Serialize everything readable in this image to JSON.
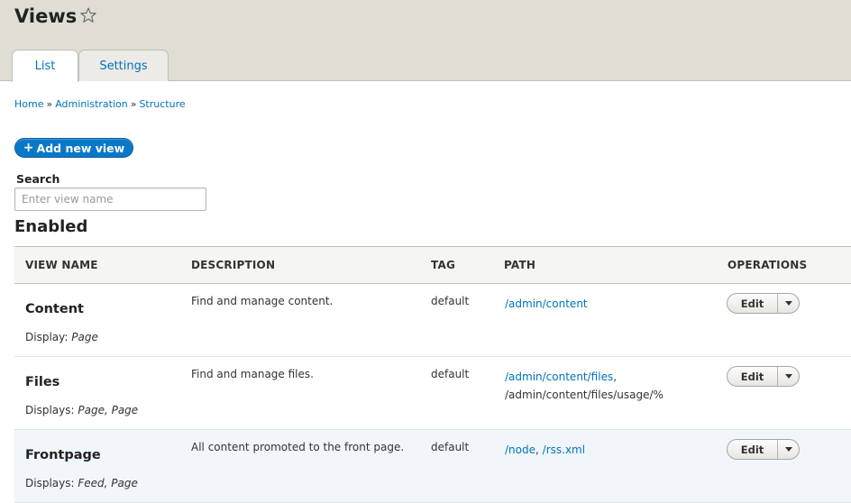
{
  "page": {
    "title": "Views"
  },
  "tabs": [
    {
      "label": "List",
      "active": true
    },
    {
      "label": "Settings",
      "active": false
    }
  ],
  "breadcrumb": {
    "items": [
      "Home",
      "Administration",
      "Structure"
    ],
    "separator": "»"
  },
  "actions": {
    "add_view_label": "Add new view",
    "add_icon": "+"
  },
  "search": {
    "label": "Search",
    "placeholder": "Enter view name",
    "value": ""
  },
  "enabled_section": {
    "heading": "Enabled"
  },
  "table": {
    "headers": {
      "view_name": "VIEW NAME",
      "description": "DESCRIPTION",
      "tag": "TAG",
      "path": "PATH",
      "operations": "OPERATIONS"
    },
    "rows": [
      {
        "name": "Content",
        "display_label": "Display:",
        "displays": "Page",
        "description": "Find and manage content.",
        "tag": "default",
        "path_link_1": "/admin/content",
        "path_rest": "",
        "edit_label": "Edit"
      },
      {
        "name": "Files",
        "display_label": "Displays:",
        "displays": "Page, Page",
        "description": "Find and manage files.",
        "tag": "default",
        "path_link_1": "/admin/content/files",
        "path_sep": ",",
        "path_line2": "/admin/content/files/usage/%",
        "edit_label": "Edit"
      },
      {
        "name": "Frontpage",
        "display_label": "Displays:",
        "displays": "Feed, Page",
        "description": "All content promoted to the front page.",
        "tag": "default",
        "path_link_1": "/node",
        "path_sep": ",",
        "path_link_2": "/rss.xml",
        "edit_label": "Edit"
      }
    ]
  },
  "colors": {
    "header_bg": "#e0ddd4",
    "link": "#0074bd",
    "primary_button": "#0a78c8",
    "highlight_row": "#f1f6fb"
  },
  "icons": {
    "favorite": "star-outline-icon",
    "dropdown": "caret-down-icon"
  }
}
